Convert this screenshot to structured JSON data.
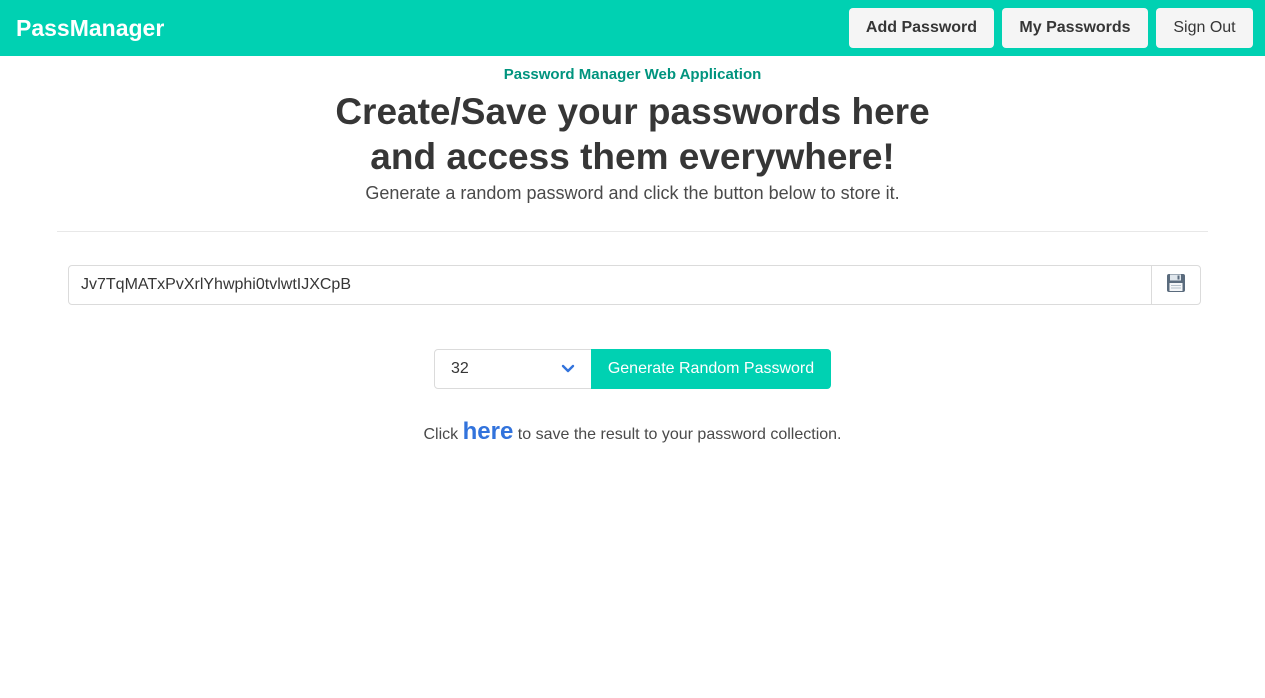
{
  "navbar": {
    "brand": "PassManager",
    "accent_color": "#00d1b2",
    "buttons": {
      "add": "Add Password",
      "mine": "My Passwords",
      "signout": "Sign Out"
    }
  },
  "hero": {
    "subtitle": "Password Manager Web Application",
    "title_line1": "Create/Save your passwords here",
    "title_line2": "and access them everywhere!",
    "lead": "Generate a random password and click the button below to store it."
  },
  "generator": {
    "password_value": "Jv7TqMATxPvXrlYhwphi0tvlwtIJXCpB",
    "save_icon": "floppy-disk-icon",
    "length_selected": "32",
    "generate_label": "Generate Random Password"
  },
  "hint": {
    "prefix": "Click",
    "link": "here",
    "suffix": "to save the result to your password collection."
  }
}
